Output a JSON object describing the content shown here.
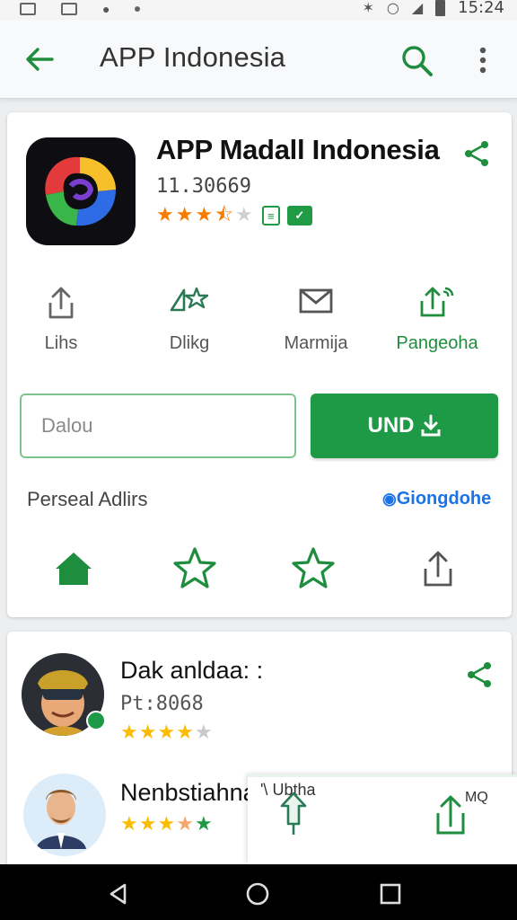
{
  "status_bar": {
    "time": "15:24"
  },
  "app_bar": {
    "title": "APP Indonesia"
  },
  "app": {
    "name": "APP Madall Indonesia",
    "id": "11.30669",
    "rating": 3.5,
    "actions": [
      {
        "label": "Lihs"
      },
      {
        "label": "Dlikg"
      },
      {
        "label": "Marmija"
      },
      {
        "label": "Pangeoha"
      }
    ],
    "input_value": "Dalou",
    "install_label": "UND",
    "section_label": "Perseal Adlirs",
    "link_label": "Giongdohe"
  },
  "reviews": [
    {
      "name": "Dak anldaa: :",
      "sub": "Pt:8068",
      "rating": 4
    },
    {
      "name": "Nenbstiahna",
      "sub": "",
      "rating": 4.5
    }
  ],
  "popup": {
    "text_left": "'\\ Ubtha",
    "text_right": "MQ"
  },
  "colors": {
    "accent": "#1e9a46",
    "link": "#1a73e8",
    "star_orange": "#f57c00",
    "star_yellow": "#fbbc04"
  }
}
